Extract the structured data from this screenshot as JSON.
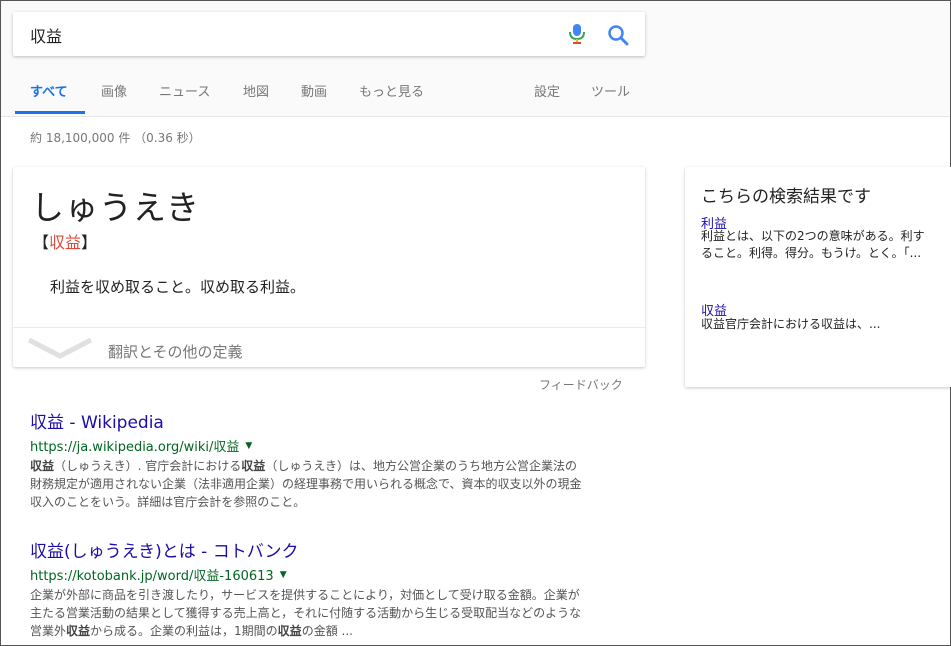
{
  "search": {
    "query": "収益"
  },
  "tabs": [
    {
      "label": "すべて",
      "active": true
    },
    {
      "label": "画像"
    },
    {
      "label": "ニュース"
    },
    {
      "label": "地図"
    },
    {
      "label": "動画"
    },
    {
      "label": "もっと見る"
    },
    {
      "label": "設定"
    },
    {
      "label": "ツール"
    }
  ],
  "result_stats": "約 18,100,000 件 （0.36 秒）",
  "dictionary": {
    "reading": "しゅうえき",
    "bracket_open": "【",
    "kanji": "収益",
    "bracket_close": "】",
    "definition": "利益を収め取ること。収め取る利益。",
    "more_label": "翻訳とその他の定義"
  },
  "feedback": "フィードバック",
  "results": [
    {
      "title": "収益 - Wikipedia",
      "url": "https://ja.wikipedia.org/wiki/収益",
      "snippet_lines": [
        [
          "収益",
          "（しゅうえき）. 官庁会計における",
          "収益",
          "（しゅうえき）は、地方公営企業のうち地方公営企業法の"
        ],
        [
          "財務規定が適用されない企業（法非適用企業）の経理事務で用いられる概念で、資本的収支以外の現金"
        ],
        [
          "収入のことをいう。詳細は官庁会計を参照のこと。"
        ]
      ]
    },
    {
      "title": "収益(しゅうえき)とは - コトバンク",
      "url": "https://kotobank.jp/word/収益-160613",
      "snippet_lines": [
        [
          "企業が外部に商品を引き渡したり，サービスを提供することにより，対価として受け取る金額。企業が"
        ],
        [
          "主たる営業活動の結果として獲得する売上高と，それに付随する活動から生じる受取配当などのような"
        ],
        [
          "営業外",
          "収益",
          "から成る。企業の利益は，1期間の",
          "収益",
          "の金額 ..."
        ]
      ]
    }
  ],
  "side_panel": {
    "title": "こちらの検索結果です",
    "items": [
      {
        "link": "利益",
        "text_lines": [
          "利益とは、以下の2つの意味がある。利す",
          "ること。利得。得分。もうけ。とく。「..."
        ]
      },
      {
        "link": "収益",
        "text_lines": [
          "収益官庁会計における収益は、..."
        ]
      }
    ]
  }
}
